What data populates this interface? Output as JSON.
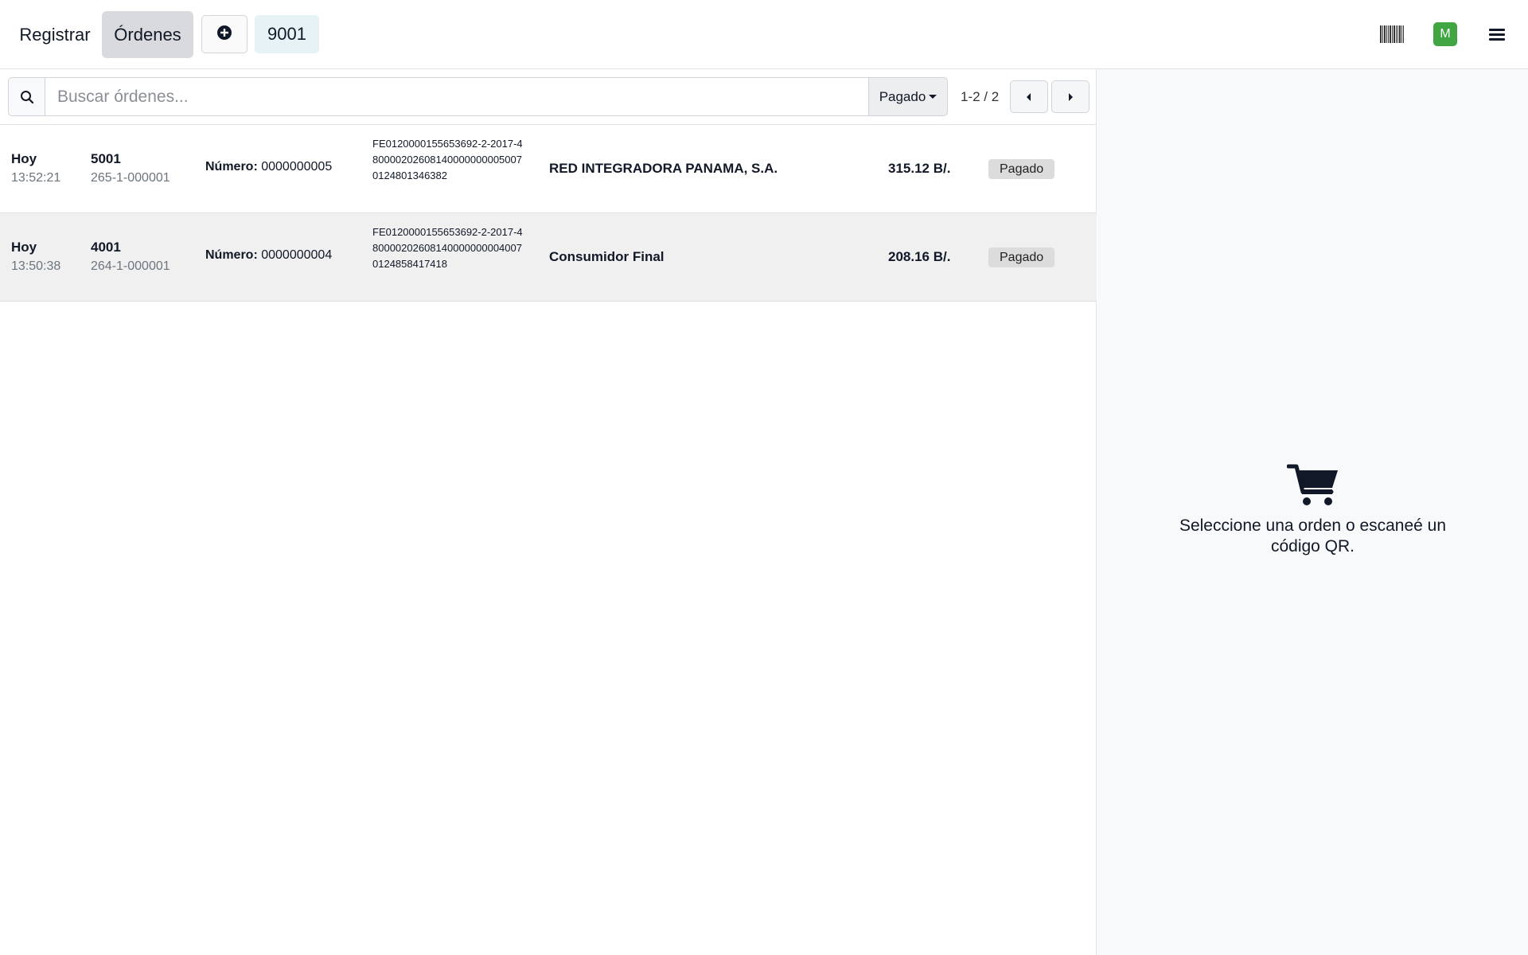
{
  "header": {
    "register_label": "Registrar",
    "orders_label": "Órdenes",
    "current_order_number": "9001",
    "avatar_initial": "M",
    "colors": {
      "avatar": "#3fa642",
      "active_tab": "#d8dadd",
      "order_chip": "#e6f2f5"
    },
    "icons": [
      "plus-circle-icon",
      "barcode-icon",
      "menu-icon"
    ]
  },
  "search": {
    "placeholder": "Buscar órdenes...",
    "value": "",
    "filter_label": "Pagado",
    "pager_text": "1-2 / 2"
  },
  "orders": [
    {
      "date": "Hoy",
      "time": "13:52:21",
      "ref": "5001",
      "receipt": "265-1-000001",
      "number_label": "Número:",
      "number_value": "0000000005",
      "fe_code": "FE0120000155653692-2-2017-4800002026081400000000050070124801346382",
      "client": "RED INTEGRADORA PANAMA, S.A.",
      "total": "315.12 B/.",
      "status": "Pagado"
    },
    {
      "date": "Hoy",
      "time": "13:50:38",
      "ref": "4001",
      "receipt": "264-1-000001",
      "number_label": "Número:",
      "number_value": "0000000004",
      "fe_code": "FE0120000155653692-2-2017-4800002026081400000000040070124858417418",
      "client": "Consumidor Final",
      "total": "208.16 B/.",
      "status": "Pagado"
    }
  ],
  "detail": {
    "empty_message": "Seleccione una orden o escaneé un código QR.",
    "icon": "cart-icon"
  }
}
